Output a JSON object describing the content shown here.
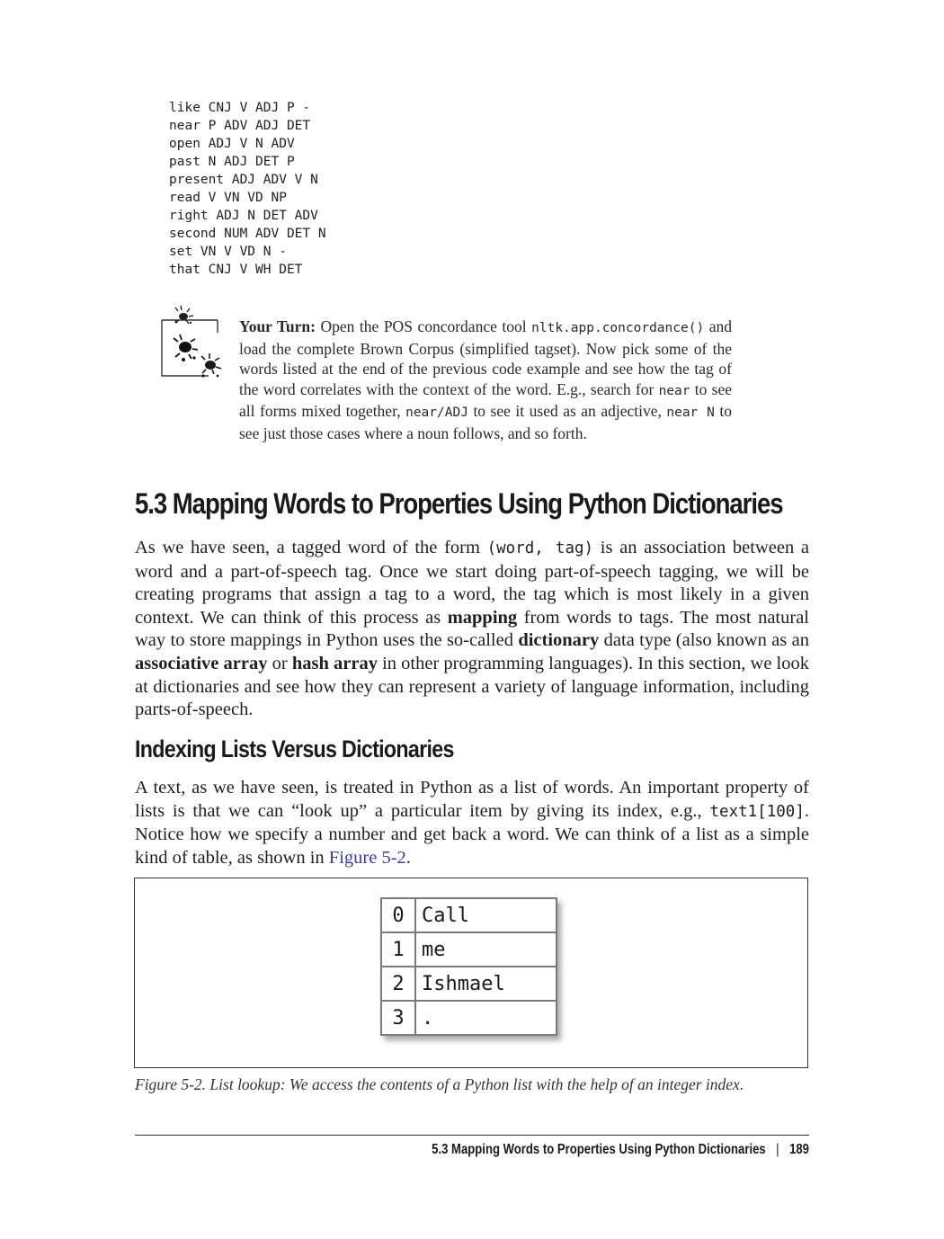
{
  "code_listing": [
    "like CNJ V ADJ P -",
    "near P ADV ADJ DET",
    "open ADJ V N ADV",
    "past N ADJ DET P",
    "present ADJ ADV V N",
    "read V VN VD NP",
    "right ADJ N DET ADV",
    "second NUM ADV DET N",
    "set VN V VD N -",
    "that CNJ V WH DET"
  ],
  "tip": {
    "icon": "scorpion-tip-icon",
    "lead": "Your Turn:",
    "t1": " Open the POS concordance tool ",
    "c1": "nltk.app.concordance()",
    "t2": " and load the complete Brown Corpus (simplified tagset). Now pick some of the words listed at the end of the previous code example and see how the tag of the word correlates with the context of the word. E.g., search for ",
    "c2": "near",
    "t3": " to see all forms mixed together, ",
    "c3": "near/ADJ",
    "t4": " to see it used as an adjective, ",
    "c4": "near N",
    "t5": " to see just those cases where a noun follows, and so forth."
  },
  "section": {
    "heading": "5.3  Mapping Words to Properties Using Python Dictionaries"
  },
  "para1": {
    "t1": "As we have seen, a tagged word of the form ",
    "c1": "(word, tag)",
    "t2": " is an association between a word and a part-of-speech tag. Once we start doing part-of-speech tagging, we will be creating programs that assign a tag to a word, the tag which is most likely in a given context. We can think of this process as ",
    "b1": "mapping",
    "t3": " from words to tags. The most natural way to store mappings in Python uses the so-called ",
    "b2": "dictionary",
    "t4": " data type (also known as an ",
    "b3": "associative array",
    "t5": " or ",
    "b4": "hash array",
    "t6": " in other programming languages). In this section, we look at dictionaries and see how they can represent a variety of language information, including parts-of-speech."
  },
  "subsection": {
    "heading": "Indexing Lists Versus Dictionaries"
  },
  "para2": {
    "t1": "A text, as we have seen, is treated in Python as a list of words. An important property of lists is that we can “look up” a particular item by giving its index, e.g., ",
    "c1": "text1[100]",
    "t2": ". Notice how we specify a number and get back a word. We can think of a list as a simple kind of table, as shown in ",
    "link": "Figure 5-2",
    "t3": "."
  },
  "figure": {
    "rows": [
      {
        "index": "0",
        "value": "Call"
      },
      {
        "index": "1",
        "value": "me"
      },
      {
        "index": "2",
        "value": "Ishmael"
      },
      {
        "index": "3",
        "value": "."
      }
    ],
    "caption": "Figure 5-2. List lookup: We access the contents of a Python list with the help of an integer index."
  },
  "footer": {
    "running_title": "5.3  Mapping Words to Properties Using Python Dictionaries",
    "separator": "|",
    "page_number": "189"
  }
}
